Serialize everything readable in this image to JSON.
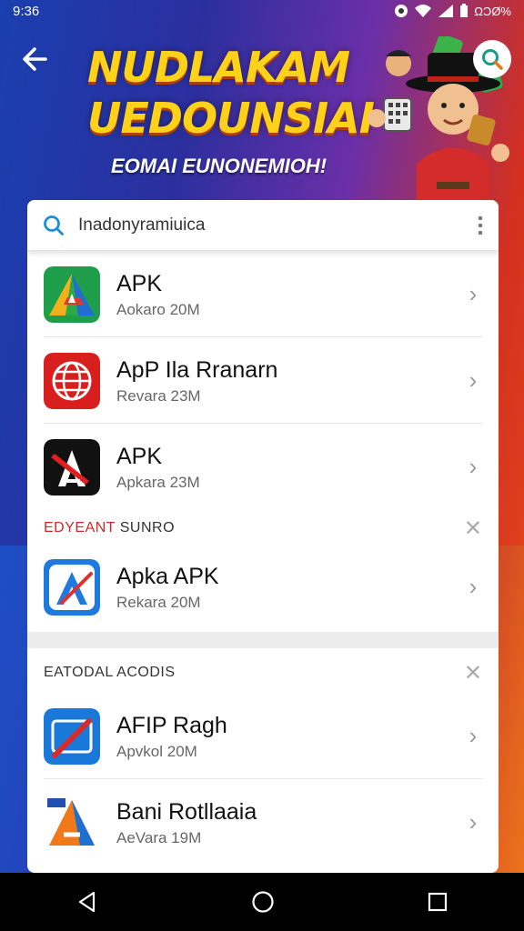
{
  "status": {
    "time": "9:36",
    "battery": "ΩƆØ%"
  },
  "banner": {
    "title_line1": "NUDLAKAM",
    "title_line2": "UEDOUNSIAI",
    "subtitle": "EOMAI EUNONEMIOH!"
  },
  "search": {
    "value": "Inadonyramiuica"
  },
  "items": [
    {
      "title": "APK",
      "sub": "Aokaro 20M"
    },
    {
      "title": "ApP Ila Rranarn",
      "sub": "Revara 23M"
    },
    {
      "title": "APK",
      "sub": "Apkara 23M"
    }
  ],
  "section1": {
    "label_red": "EDYEANT",
    "label_rest": " SUNRO",
    "items": [
      {
        "title": "Apka APK",
        "sub": "Rekara 20M"
      }
    ]
  },
  "section2": {
    "label": "EATODAL ACODIS",
    "items": [
      {
        "title": "AFIP Ragh",
        "sub": "Apvkol 20M"
      },
      {
        "title": "Bani Rotllaaia",
        "sub": "AeVara 19M"
      }
    ]
  },
  "colors": {
    "accent": "#ffd21a",
    "red_label": "#d0282a",
    "search_icon": "#1a8fd8"
  }
}
